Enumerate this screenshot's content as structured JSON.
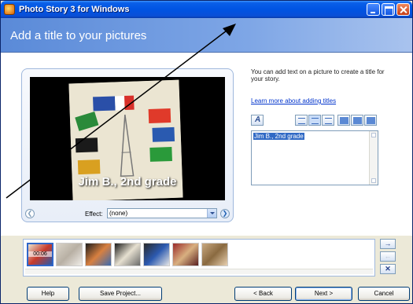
{
  "window": {
    "title": "Photo Story 3 for Windows"
  },
  "header": {
    "title": "Add a title to your pictures"
  },
  "preview": {
    "caption": "Jim B., 2nd grade",
    "effect_label": "Effect:",
    "effect_value": "(none)"
  },
  "sidebar": {
    "help_text": "You can add text on a picture to create a title for your story.",
    "learn_link": "Learn more about adding titles",
    "text_value": "Jim B., 2nd grade"
  },
  "filmstrip": {
    "selected_time": "00:06",
    "thumbs": [
      {
        "colors": [
          "#e9e3cf",
          "#c83a2a",
          "#2a5aa8"
        ]
      },
      {
        "colors": [
          "#d9d3c8",
          "#b8b0a4",
          "#f0ede8"
        ]
      },
      {
        "colors": [
          "#1c1c1c",
          "#d88040",
          "#3b6bb0"
        ]
      },
      {
        "colors": [
          "#1a1a1a",
          "#e6e0d0",
          "#6a6a6a"
        ]
      },
      {
        "colors": [
          "#2a2a2a",
          "#2c5ab0",
          "#e6e6e6"
        ]
      },
      {
        "colors": [
          "#9a2a2a",
          "#d8b080",
          "#5a2020"
        ]
      },
      {
        "colors": [
          "#c8a880",
          "#8a6a40",
          "#e8d0b0"
        ]
      }
    ]
  },
  "buttons": {
    "help": "Help",
    "save": "Save Project...",
    "back": "< Back",
    "next": "Next >",
    "cancel": "Cancel"
  },
  "colors": {
    "accent": "#0054e3",
    "selection": "#316ac5"
  }
}
